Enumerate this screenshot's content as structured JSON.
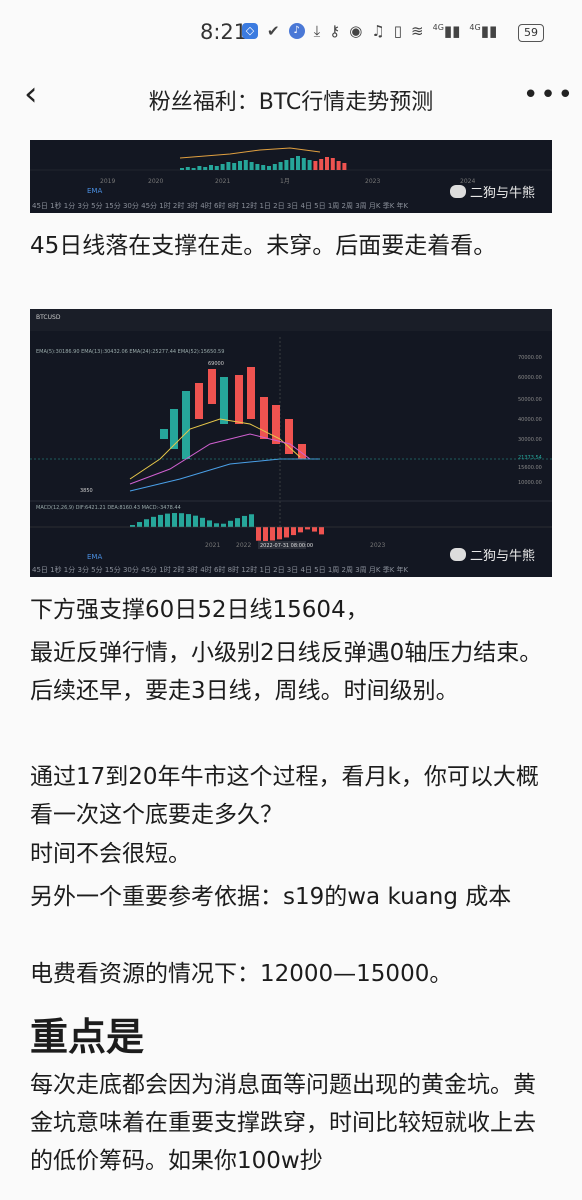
{
  "status_bar": {
    "time": "8:21",
    "battery": "59",
    "signal1": "4G",
    "signal2": "4G"
  },
  "nav": {
    "title": "粉丝福利：BTC行情走势预测",
    "back": "‹",
    "more": "•••"
  },
  "chart1": {
    "watermark": "二狗与牛熊",
    "years": [
      "2019",
      "2020",
      "2021",
      "1月",
      "2023",
      "2024"
    ],
    "indicator": "EMA",
    "timeframes": "45日 1秒 1分 3分 5分 15分 30分 45分 1时 2时 3时 4时 6时 8时 12时 1日 2日 3日 4日 5日 1周 2周 3周 月K 季K 年K"
  },
  "para1": "45日线落在支撑在走。未穿。后面要走着看。",
  "chart2": {
    "watermark": "二狗与牛熊",
    "symbol": "BTCUSD",
    "ema_line": "EMA(5):30186.90  EMA(13):30432.06  EMA(24):25277.44  EMA(52):15650.59",
    "macd_line": "MACD(12,26,9)  DIF:6421.21  DEA:8160.43  MACD:-3478.44",
    "price_labels": [
      "70000.00",
      "60000.00",
      "50000.00",
      "40000.00",
      "30000.00",
      "21373.54",
      "15600.00",
      "10000.00"
    ],
    "low_label": "3850",
    "high_label": "69000",
    "date_label": "2022-07-31 08:00:00",
    "years": [
      "2021",
      "2022",
      "2023"
    ],
    "indicator": "EMA",
    "timeframes": "45日 1秒 1分 3分 5分 15分 30分 45分 1时 2时 3时 4时 6时 8时 12时 1日 2日 3日 4日 5日 1周 2周 3周 月K 季K 年K"
  },
  "para2": [
    "下方强支撑60日52日线15604，",
    "最近反弹行情，小级别2日线反弹遇0轴压力结束。后续还早，要走3日线，周线。时间级别。",
    "通过17到20年牛市这个过程，看月k，你可以大概看一次这个底要走多久？",
    "时间不会很短。",
    "另外一个重要参考依据：s19的wa kuang 成本",
    "电费看资源的情况下：12000—15000。"
  ],
  "heading": "重点是",
  "para3": "每次走底都会因为消息面等问题出现的黄金坑。黄金坑意味着在重要支撑跌穿，时间比较短就收上去的低价筹码。如果你100w抄"
}
